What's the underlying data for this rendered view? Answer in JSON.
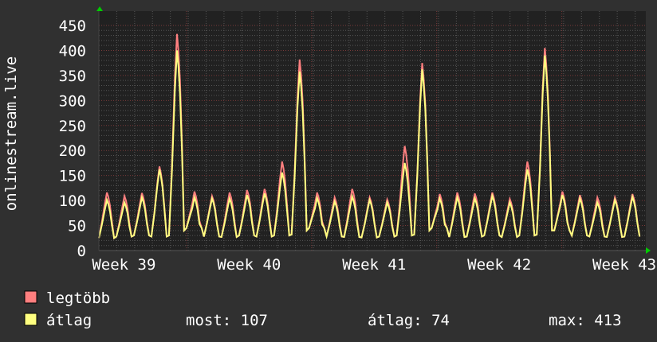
{
  "chart_data": {
    "type": "line",
    "ylabel": "onlinestream.live",
    "ylim": [
      0,
      450
    ],
    "yticks": [
      0,
      50,
      100,
      150,
      200,
      250,
      300,
      350,
      400,
      450
    ],
    "x_unit": "days",
    "xlim": [
      0,
      30.6
    ],
    "xticks": [
      {
        "label": "Week 39",
        "x": 1.4
      },
      {
        "label": "Week 40",
        "x": 8.4
      },
      {
        "label": "Week 41",
        "x": 15.4
      },
      {
        "label": "Week 42",
        "x": 22.4
      },
      {
        "label": "Week 43",
        "x": 29.4
      }
    ],
    "week_boundaries": [
      4.9,
      11.9,
      18.9,
      25.9
    ],
    "grid": true,
    "first_peak_day": 0.45,
    "series": [
      {
        "name": "legtöbb",
        "color": "#ff7f7f",
        "daily_peaks": [
          116,
          109,
          115,
          168,
          433,
          118,
          109,
          116,
          121,
          123,
          178,
          382,
          116,
          106,
          123,
          106,
          102,
          209,
          375,
          113,
          116,
          114,
          116,
          103,
          178,
          405,
          118,
          111,
          106,
          106,
          113
        ]
      },
      {
        "name": "átlag",
        "color": "#ffff80",
        "daily_peaks": [
          101,
          96,
          106,
          162,
          400,
          106,
          104,
          104,
          111,
          114,
          156,
          358,
          105,
          98,
          108,
          101,
          96,
          175,
          362,
          104,
          106,
          104,
          109,
          96,
          162,
          390,
          111,
          104,
          96,
          101,
          107
        ]
      }
    ],
    "daily_troughs": [
      25,
      28,
      30,
      28,
      30,
      45,
      28,
      27,
      30,
      28,
      30,
      32,
      45,
      28,
      27,
      26,
      28,
      30,
      32,
      45,
      27,
      28,
      30,
      27,
      30,
      32,
      40,
      30,
      28,
      27,
      28
    ]
  },
  "legend": {
    "items": [
      {
        "label": "legtöbb",
        "color": "#ff7f7f"
      },
      {
        "label": "átlag",
        "color": "#ffff80"
      }
    ],
    "stats": {
      "now": "most: 107",
      "avg": "átlag: 74",
      "max": "max: 413"
    }
  }
}
